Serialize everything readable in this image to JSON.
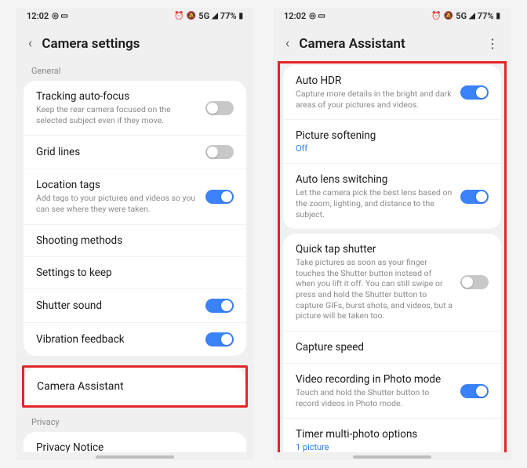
{
  "status": {
    "time": "12:02",
    "icons_left": "◎ ▭",
    "alarm": "⏰",
    "mute": "🔕",
    "network": "5G",
    "signal": "◢",
    "battery_pct": "77%",
    "battery": "▮"
  },
  "left": {
    "title": "Camera settings",
    "section_general": "General",
    "rows": {
      "tracking_autofocus": {
        "title": "Tracking auto-focus",
        "desc": "Keep the rear camera focused on the selected subject even if they move."
      },
      "grid_lines": {
        "title": "Grid lines"
      },
      "location_tags": {
        "title": "Location tags",
        "desc": "Add tags to your pictures and videos so you can see where they were taken."
      },
      "shooting_methods": {
        "title": "Shooting methods"
      },
      "settings_to_keep": {
        "title": "Settings to keep"
      },
      "shutter_sound": {
        "title": "Shutter sound"
      },
      "vibration_feedback": {
        "title": "Vibration feedback"
      },
      "camera_assistant": {
        "title": "Camera Assistant"
      }
    },
    "section_privacy": "Privacy",
    "privacy_notice": {
      "title": "Privacy Notice"
    }
  },
  "right": {
    "title": "Camera Assistant",
    "rows": {
      "auto_hdr": {
        "title": "Auto HDR",
        "desc": "Capture more details in the bright and dark areas of your pictures and videos."
      },
      "picture_softening": {
        "title": "Picture softening",
        "value": "Off"
      },
      "auto_lens": {
        "title": "Auto lens switching",
        "desc": "Let the camera pick the best lens based on the zoom, lighting, and distance to the subject."
      },
      "quick_tap": {
        "title": "Quick tap shutter",
        "desc": "Take pictures as soon as your finger touches the Shutter button instead of when you lift it off. You can still swipe or press and hold the Shutter button to capture GIFs, burst shots, and videos, but a picture will be taken too."
      },
      "capture_speed": {
        "title": "Capture speed"
      },
      "video_recording": {
        "title": "Video recording in Photo mode",
        "desc": "Touch and hold the Shutter button to record videos in Photo mode."
      },
      "timer": {
        "title": "Timer multi-photo options",
        "value": "1 picture"
      }
    }
  }
}
